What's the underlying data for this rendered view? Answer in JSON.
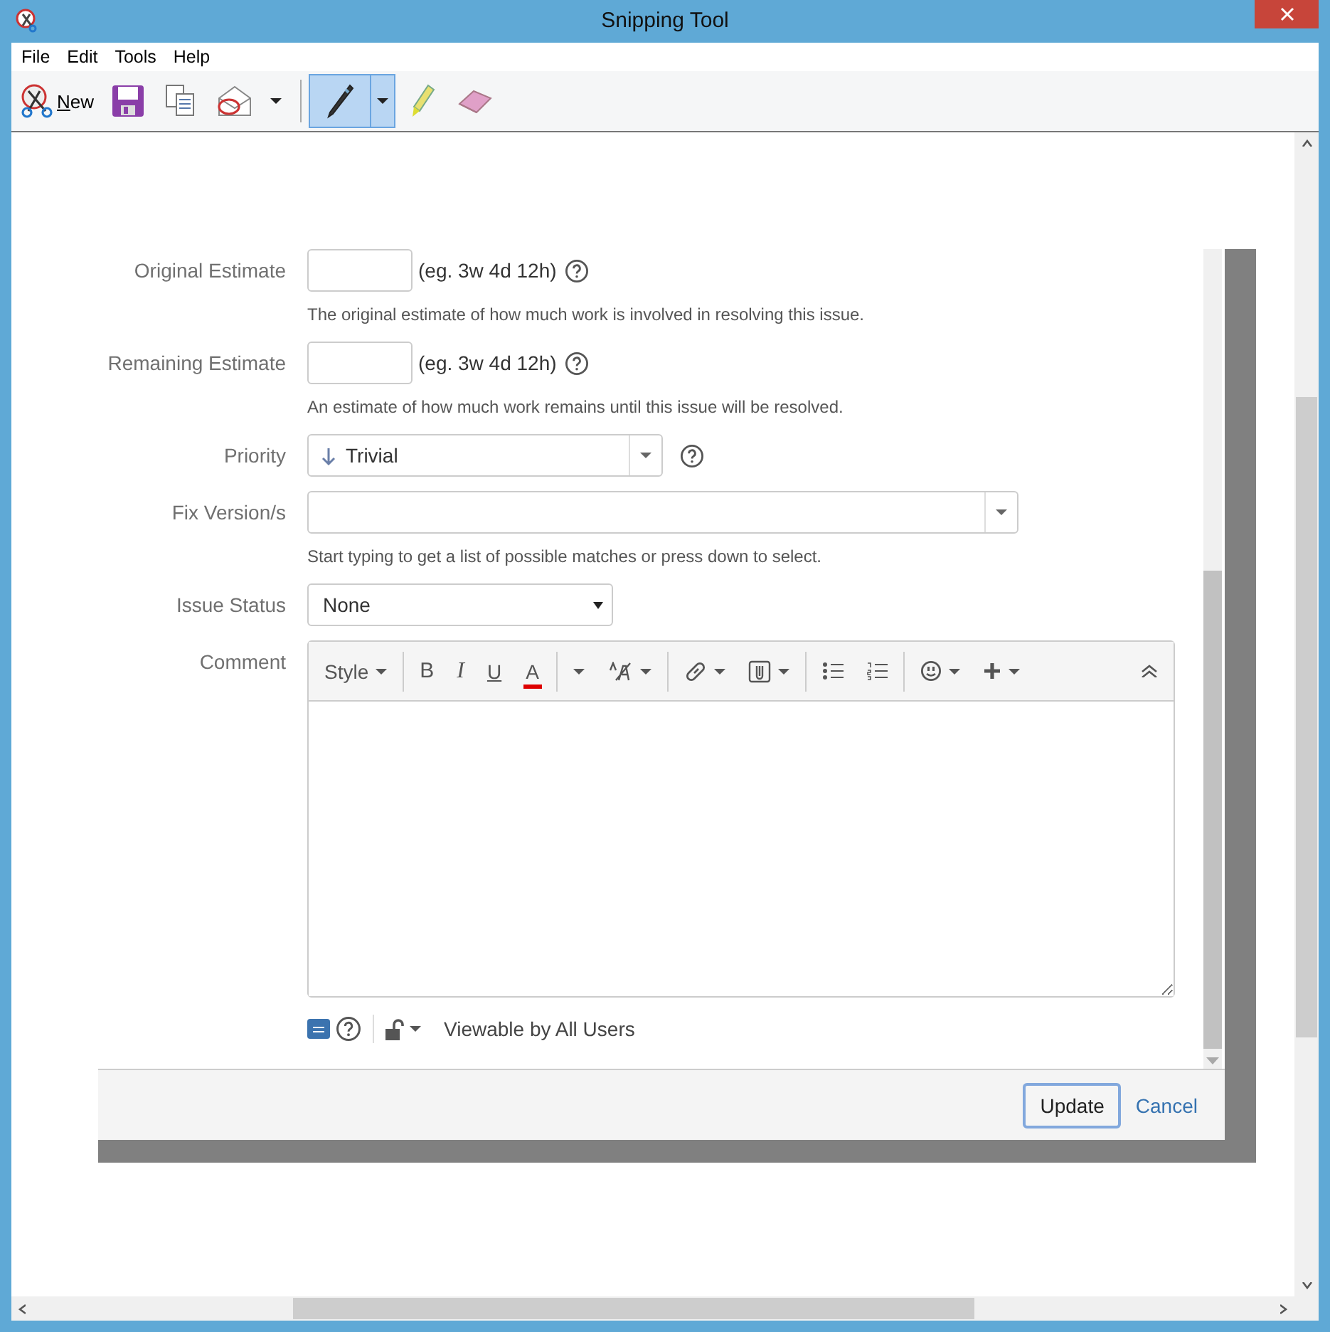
{
  "window": {
    "title": "Snipping Tool"
  },
  "menu": [
    "File",
    "Edit",
    "Tools",
    "Help"
  ],
  "toolbar": {
    "new_label": "New",
    "tools": [
      {
        "kind": "pen",
        "selected": true
      },
      {
        "kind": "highlighter",
        "selected": false
      },
      {
        "kind": "eraser",
        "selected": false
      }
    ]
  },
  "form": [
    {
      "kind": "duration",
      "label": "Original Estimate",
      "hint": "(eg. 3w 4d 12h)",
      "description": "The original estimate of how much work is involved in resolving this issue."
    },
    {
      "kind": "duration",
      "label": "Remaining Estimate",
      "hint": "(eg. 3w 4d 12h)",
      "description": "An estimate of how much work remains until this issue will be resolved."
    },
    {
      "kind": "priority",
      "label": "Priority",
      "value": "Trivial"
    },
    {
      "kind": "versions",
      "label": "Fix Version/s",
      "description": "Start typing to get a list of possible matches or press down to select."
    },
    {
      "kind": "dropdown",
      "label": "Issue Status",
      "value": "None"
    },
    {
      "kind": "editor",
      "label": "Comment"
    }
  ],
  "editor_toolbar": {
    "style": "Style",
    "bold": "B",
    "italic": "I",
    "underline": "U",
    "font_color": "A"
  },
  "visibility": "Viewable by All Users",
  "buttons": {
    "update": "Update",
    "cancel": "Cancel"
  }
}
